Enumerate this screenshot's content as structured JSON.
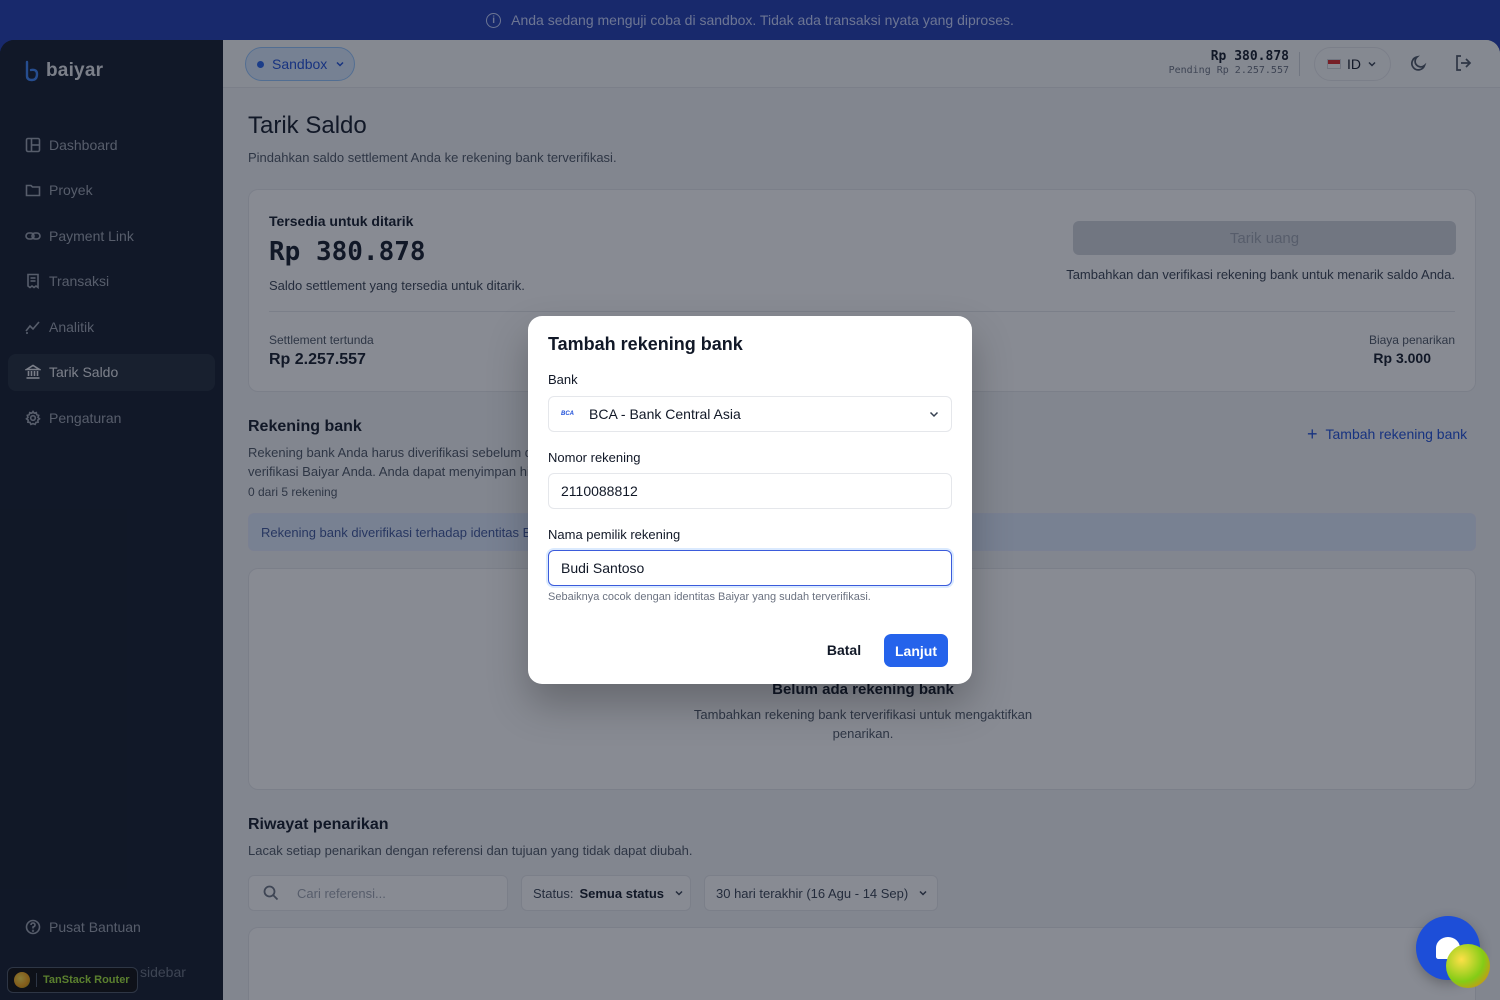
{
  "banner": {
    "text": "Anda sedang menguji coba di sandbox. Tidak ada transaksi nyata yang diproses."
  },
  "app": {
    "name": "baiyar"
  },
  "sidebar": {
    "items": [
      {
        "label": "Dashboard",
        "icon": "dashboard-icon"
      },
      {
        "label": "Proyek",
        "icon": "folder-icon"
      },
      {
        "label": "Payment Link",
        "icon": "link-icon"
      },
      {
        "label": "Transaksi",
        "icon": "receipt-icon"
      },
      {
        "label": "Analitik",
        "icon": "chart-icon"
      },
      {
        "label": "Tarik Saldo",
        "icon": "bank-icon",
        "active": true
      },
      {
        "label": "Pengaturan",
        "icon": "gear-icon"
      }
    ],
    "help": "Pusat Bantuan",
    "router_badge": "TanStack Router",
    "sidebar_text": "sidebar"
  },
  "topbar": {
    "environment": "Sandbox",
    "balance": "Rp 380.878",
    "pending": "Pending Rp 2.257.557",
    "language": "ID"
  },
  "page": {
    "title": "Tarik Saldo",
    "subtitle": "Pindahkan saldo settlement Anda ke rekening bank terverifikasi."
  },
  "balance_card": {
    "label": "Tersedia untuk ditarik",
    "amount": "Rp 380.878",
    "description": "Saldo settlement yang tersedia untuk ditarik.",
    "withdraw_button": "Tarik uang",
    "withdraw_note": "Tambahkan dan verifikasi rekening bank untuk menarik saldo Anda.",
    "pending_label": "Settlement tertunda",
    "pending_amount": "Rp 2.257.557",
    "fee_label": "Biaya penarikan",
    "fee_amount": "Rp 3.000"
  },
  "bank_section": {
    "title": "Rekening bank",
    "text_line1": "Rekening bank Anda harus diverifikasi sebelum da",
    "text_line2": "verifikasi Baiyar Anda. Anda dapat menyimpan hi",
    "count": "0 dari 5 rekening",
    "add_link": "Tambah rekening bank",
    "verify_note": "Rekening bank diverifikasi terhadap identitas Ba",
    "empty_title": "Belum ada rekening bank",
    "empty_text": "Tambahkan rekening bank terverifikasi untuk mengaktifkan penarikan."
  },
  "history": {
    "title": "Riwayat penarikan",
    "subtitle": "Lacak setiap penarikan dengan referensi dan tujuan yang tidak dapat diubah.",
    "search_placeholder": "Cari referensi...",
    "status_label": "Status:",
    "status_value": "Semua status",
    "date_range": "30 hari terakhir (16 Agu - 14 Sep)"
  },
  "modal": {
    "title": "Tambah rekening bank",
    "bank_label": "Bank",
    "bank_logo": "BCA",
    "bank_value": "BCA - Bank Central Asia",
    "account_label": "Nomor rekening",
    "account_value": "2110088812",
    "owner_label": "Nama pemilik rekening",
    "owner_value": "Budi Santoso",
    "hint": "Sebaiknya cocok dengan identitas Baiyar yang sudah terverifikasi.",
    "cancel": "Batal",
    "next": "Lanjut"
  },
  "colors": {
    "accent": "#2563eb",
    "sidebar_bg": "#101828",
    "banner_bg": "#1e3bb0"
  }
}
